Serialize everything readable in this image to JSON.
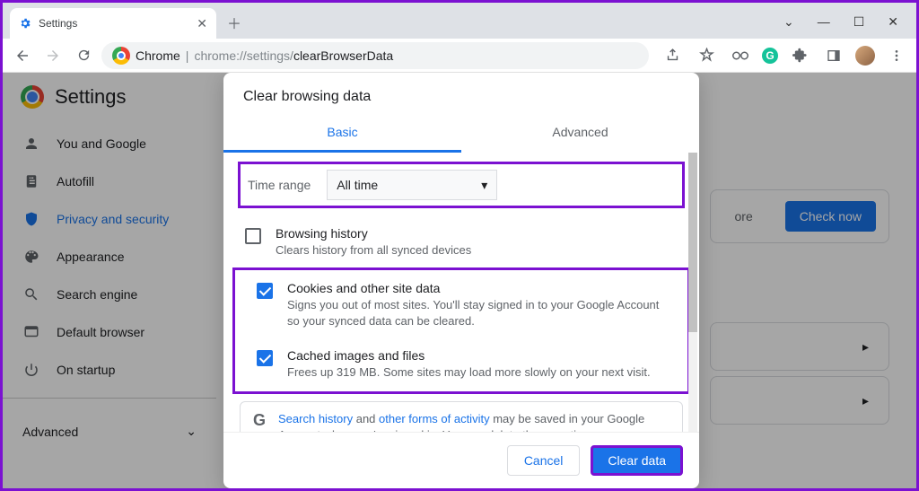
{
  "window": {
    "tab_title": "Settings"
  },
  "toolbar": {
    "host": "Chrome",
    "url_prefix": "chrome://settings/",
    "url_page": "clearBrowserData"
  },
  "settings": {
    "title": "Settings",
    "sidebar": [
      {
        "label": "You and Google"
      },
      {
        "label": "Autofill"
      },
      {
        "label": "Privacy and security"
      },
      {
        "label": "Appearance"
      },
      {
        "label": "Search engine"
      },
      {
        "label": "Default browser"
      },
      {
        "label": "On startup"
      }
    ],
    "advanced": "Advanced",
    "peek_more": "ore",
    "check_now": "Check now"
  },
  "dialog": {
    "title": "Clear browsing data",
    "tab_basic": "Basic",
    "tab_advanced": "Advanced",
    "time_range_label": "Time range",
    "time_range_value": "All time",
    "options": [
      {
        "title": "Browsing history",
        "sub": "Clears history from all synced devices"
      },
      {
        "title": "Cookies and other site data",
        "sub": "Signs you out of most sites. You'll stay signed in to your Google Account so your synced data can be cleared."
      },
      {
        "title": "Cached images and files",
        "sub": "Frees up 319 MB. Some sites may load more slowly on your next visit."
      }
    ],
    "info_link1": "Search history",
    "info_mid": " and ",
    "info_link2": "other forms of activity",
    "info_rest": " may be saved in your Google Account when you're signed in. You can delete them anytime.",
    "cancel": "Cancel",
    "clear": "Clear data"
  }
}
